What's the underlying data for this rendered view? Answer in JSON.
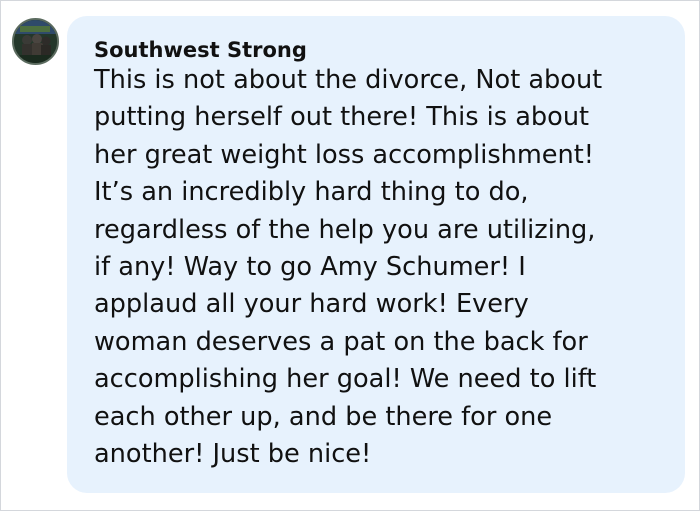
{
  "comment": {
    "author": "Southwest Strong",
    "avatar_icon": "profile-photo-icon",
    "bubble_color": "#e7f2fd",
    "lines": [
      "This is not about the divorce, Not about",
      "putting herself out there! This is about",
      "her great weight loss accomplishment!",
      "It’s an incredibly hard thing to do,",
      "regardless of the help you are utilizing,",
      "if any! Way to go Amy Schumer! I",
      "applaud all your hard work! Every",
      "woman deserves a pat on the back for",
      "accomplishing her goal! We need to lift",
      "each other up, and be there for one",
      "another! Just be nice!"
    ]
  }
}
